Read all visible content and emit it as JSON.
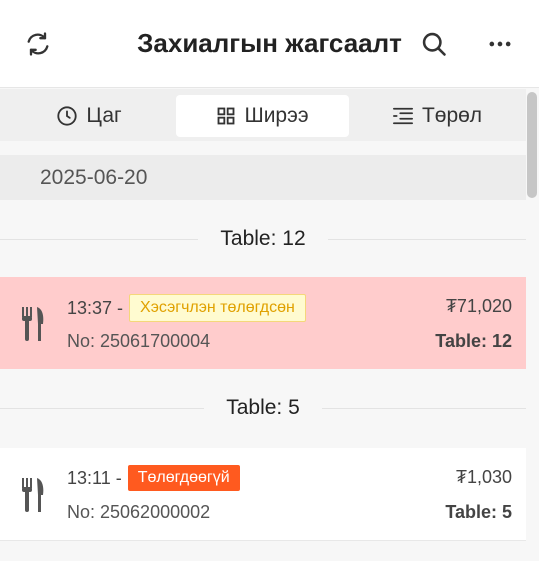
{
  "header": {
    "title": "Захиалгын жагсаалт",
    "refresh_icon": "refresh-icon",
    "search_icon": "search-icon",
    "more_icon": "more-icon"
  },
  "tabs": [
    {
      "label": "Цаг",
      "icon": "clock-icon",
      "active": false
    },
    {
      "label": "Ширээ",
      "icon": "grid-icon",
      "active": true
    },
    {
      "label": "Төрөл",
      "icon": "list-icon",
      "active": false
    }
  ],
  "date": "2025-06-20",
  "groups": [
    {
      "label": "Table: 12",
      "order": {
        "time": "13:37 -",
        "status": "Хэсэгчлэн төлөгдсөн",
        "no": "No: 25061700004",
        "amount": "₮71,020",
        "table": "Table: 12",
        "icon": "fork-knife-icon"
      }
    },
    {
      "label": "Table: 5",
      "order": {
        "time": "13:11 -",
        "status": "Төлөгдөөгүй",
        "no": "No: 25062000002",
        "amount": "₮1,030",
        "table": "Table: 5",
        "icon": "fork-knife-icon"
      }
    }
  ],
  "colors": {
    "highlight_row": "#ffcccc",
    "partial_badge": "#fffbd0",
    "unpaid_badge": "#ff5a1f"
  }
}
